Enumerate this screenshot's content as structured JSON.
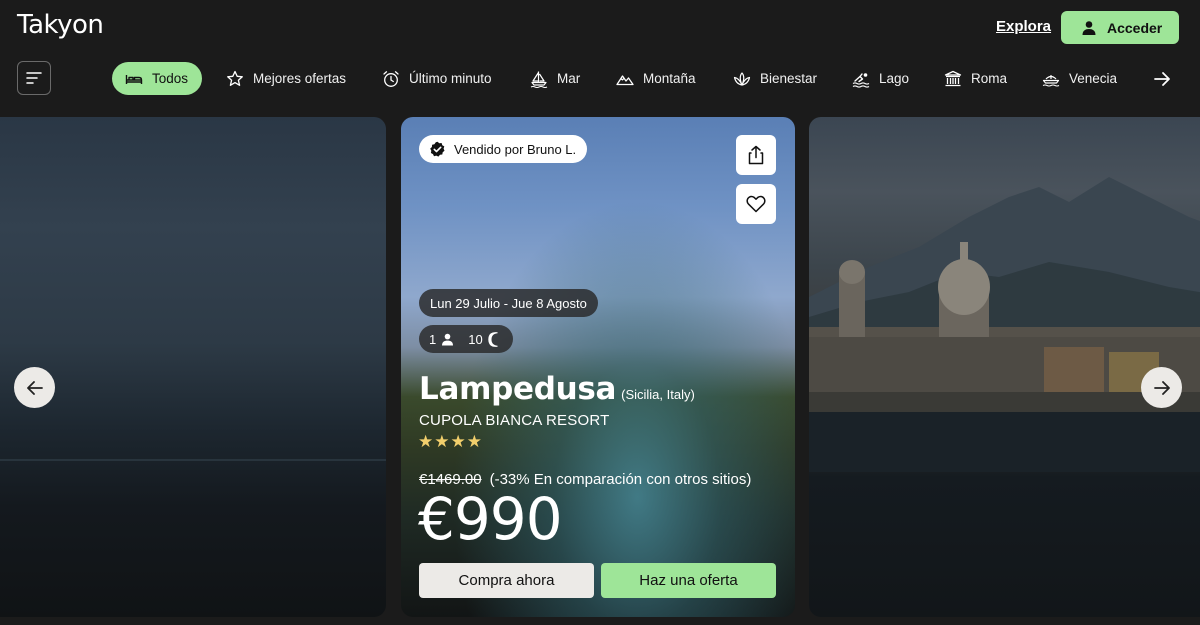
{
  "header": {
    "logo": "Takyon",
    "explore_link": "Explora",
    "login_button": "Acceder"
  },
  "categories": [
    {
      "label": "Todos",
      "icon": "bed-icon",
      "active": true
    },
    {
      "label": "Mejores ofertas",
      "icon": "star-icon",
      "active": false
    },
    {
      "label": "Último minuto",
      "icon": "alarm-clock-icon",
      "active": false
    },
    {
      "label": "Mar",
      "icon": "sailboat-icon",
      "active": false
    },
    {
      "label": "Montaña",
      "icon": "mountain-icon",
      "active": false
    },
    {
      "label": "Bienestar",
      "icon": "lotus-icon",
      "active": false
    },
    {
      "label": "Lago",
      "icon": "swimmer-icon",
      "active": false
    },
    {
      "label": "Roma",
      "icon": "monument-icon",
      "active": false
    },
    {
      "label": "Venecia",
      "icon": "gondola-icon",
      "active": false
    }
  ],
  "offer": {
    "seller": "Vendido por Bruno L.",
    "dates": "Lun 29 Julio - Jue 8 Agosto",
    "guests": "1",
    "nights": "10",
    "destination": "Lampedusa",
    "region": "(Sicilia, Italy)",
    "hotel": "CUPOLA BIANCA RESORT",
    "stars": 4,
    "stars_display": "★★★★",
    "original_price": "€1469.00",
    "discount_note": "(-33% En comparación con otros sitios)",
    "price": "€990",
    "buy_button": "Compra ahora",
    "offer_button": "Haz una oferta"
  },
  "colors": {
    "background": "#1b1b1b",
    "accent": "#9ee598",
    "stars": "#f2cf6c"
  }
}
